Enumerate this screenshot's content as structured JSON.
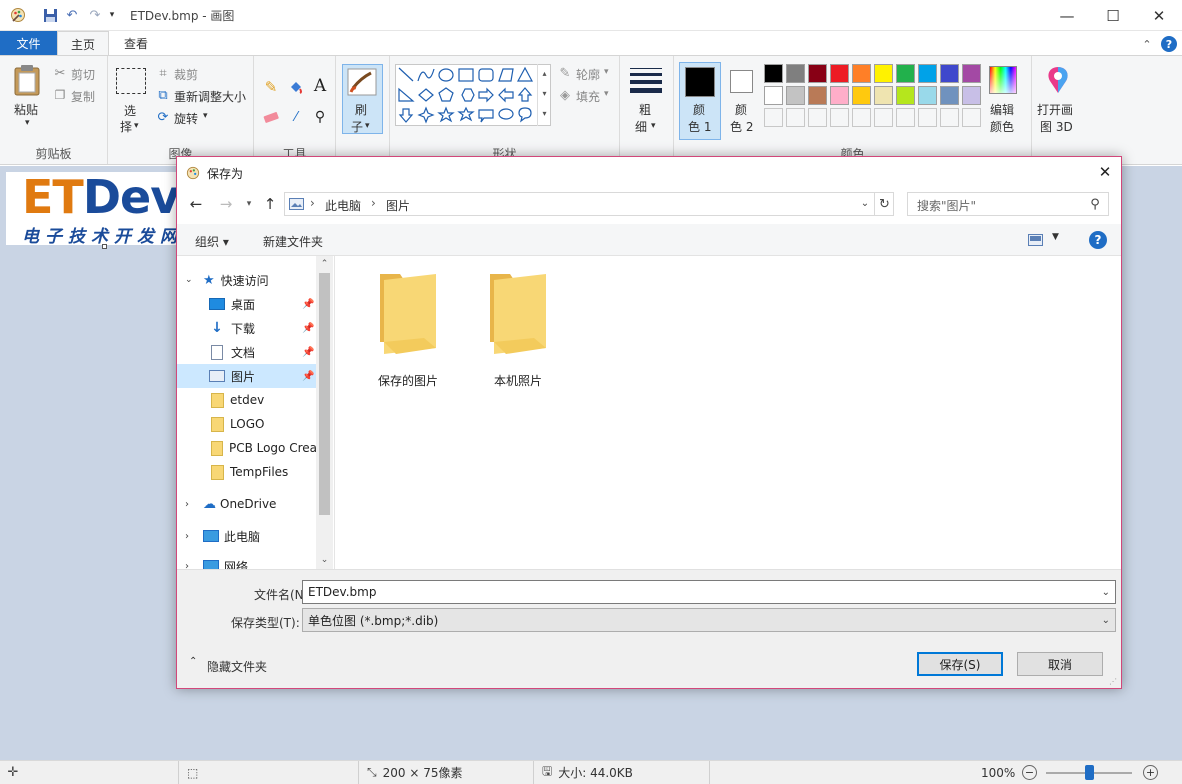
{
  "window": {
    "title": "ETDev.bmp - 画图",
    "minimize": "—",
    "maximize": "☐",
    "close": "✕"
  },
  "tabs": [
    {
      "label": "文件"
    },
    {
      "label": "主页"
    },
    {
      "label": "查看"
    }
  ],
  "ribbon": {
    "clipboard": {
      "paste": "粘贴",
      "cut": "剪切",
      "copy": "复制",
      "group": "剪贴板"
    },
    "image": {
      "select_1": "选",
      "select_2": "择",
      "crop": "裁剪",
      "resize": "重新调整大小",
      "rotate": "旋转",
      "group": "图像"
    },
    "tools": {
      "text_icon": "A",
      "group": "工具"
    },
    "brush": {
      "label_1": "刷",
      "label_2": "子"
    },
    "shapes": {
      "outline": "轮廓",
      "fill": "填充",
      "group": "形状"
    },
    "size": {
      "label_1": "粗",
      "label_2": "细"
    },
    "colors": {
      "color1_1": "颜",
      "color1_2": "色 1",
      "color2_1": "颜",
      "color2_2": "色 2",
      "edit_1": "编辑",
      "edit_2": "颜色",
      "group": "颜色",
      "palette": [
        "#000000",
        "#7f7f7f",
        "#880015",
        "#ed1c24",
        "#ff7f27",
        "#fff200",
        "#22b14c",
        "#00a2e8",
        "#3f48cc",
        "#a349a4",
        "#ffffff",
        "#c3c3c3",
        "#b97a57",
        "#ffaec9",
        "#ffc90e",
        "#efe4b0",
        "#b5e61d",
        "#99d9ea",
        "#7092be",
        "#c8bfe7",
        "#f5f6f7",
        "#f5f6f7",
        "#f5f6f7",
        "#f5f6f7",
        "#f5f6f7",
        "#f5f6f7",
        "#f5f6f7",
        "#f5f6f7",
        "#f5f6f7",
        "#f5f6f7"
      ]
    },
    "paint3d": {
      "label_1": "打开画",
      "label_2": "图 3D"
    }
  },
  "canvas": {
    "logo_text": "ETDev",
    "logo_sub": "电子技术开发网"
  },
  "dialog": {
    "title": "保存为",
    "close": "✕",
    "breadcrumb": [
      "此电脑",
      "图片"
    ],
    "search_placeholder": "搜索\"图片\"",
    "organize": "组织 ▾",
    "new_folder": "新建文件夹",
    "help": "?",
    "nav": {
      "quick_access": "快速访问",
      "items": [
        {
          "label": "桌面",
          "icon": "desktop-icon"
        },
        {
          "label": "下载",
          "icon": "download-icon"
        },
        {
          "label": "文档",
          "icon": "document-icon"
        },
        {
          "label": "图片",
          "icon": "pictures-icon"
        },
        {
          "label": "etdev",
          "icon": "folder-icon"
        },
        {
          "label": "LOGO",
          "icon": "folder-icon"
        },
        {
          "label": "PCB Logo Crea",
          "icon": "folder-icon"
        },
        {
          "label": "TempFiles",
          "icon": "folder-icon"
        }
      ],
      "onedrive": "OneDrive",
      "this_pc": "此电脑",
      "network": "网络"
    },
    "folders": [
      {
        "name": "保存的图片"
      },
      {
        "name": "本机照片"
      }
    ],
    "filename_label": "文件名(N):",
    "filename_value": "ETDev.bmp",
    "filetype_label": "保存类型(T):",
    "filetype_value": "单色位图 (*.bmp;*.dib)",
    "hide_folders": "隐藏文件夹",
    "save": "保存(S)",
    "cancel": "取消"
  },
  "status": {
    "dimensions": "200 × 75像素",
    "size": "大小: 44.0KB",
    "zoom": "100%",
    "zoom_level": 0.5
  }
}
